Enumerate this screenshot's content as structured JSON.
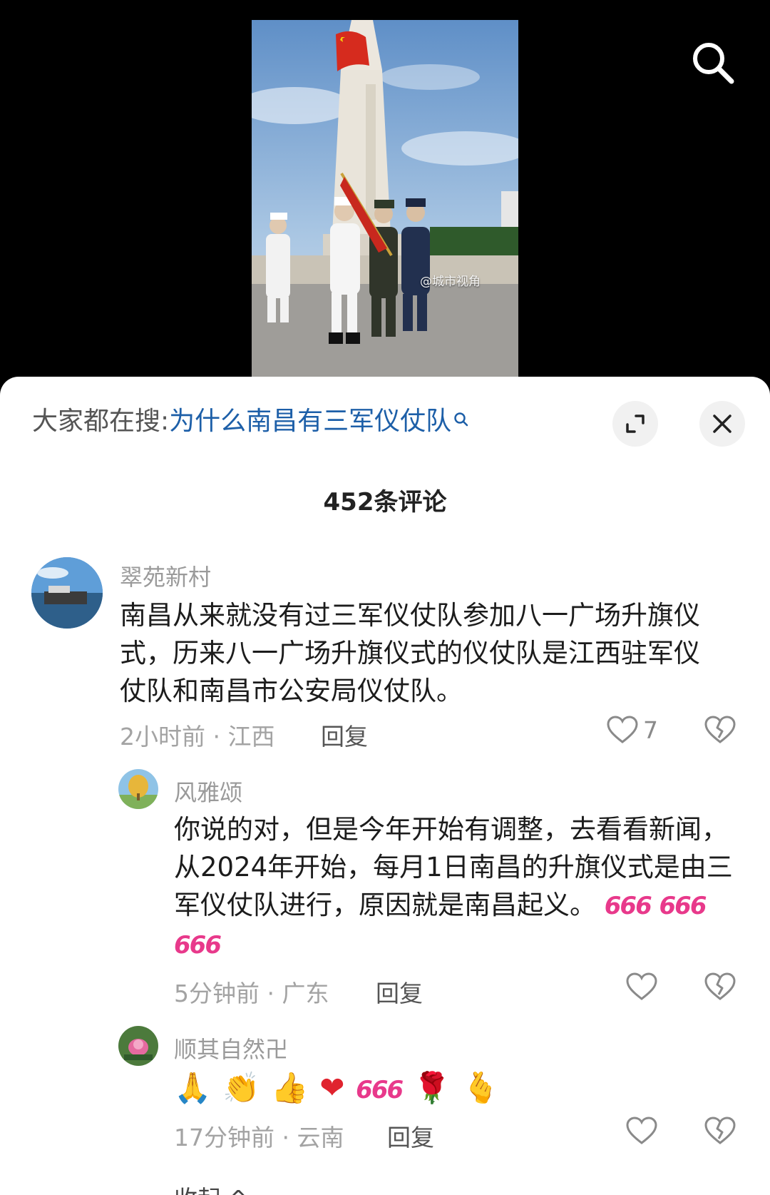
{
  "video": {
    "watermark": "@城市视角"
  },
  "header": {
    "hot_search_prefix": "大家都在搜:",
    "hot_search_query": "为什么南昌有三军仪仗队"
  },
  "comment_count": "452条评论",
  "comments": [
    {
      "user": "翠苑新村",
      "text": "南昌从来就没有过三军仪仗队参加八一广场升旗仪式，历来八一广场升旗仪式的仪仗队是江西驻军仪仗队和南昌市公安局仪仗队。",
      "meta": "2小时前 · 江西",
      "reply": "回复",
      "likes": "7"
    }
  ],
  "replies": [
    {
      "user": "风雅颂",
      "text": "你说的对，但是今年开始有调整，去看看新闻，从2024年开始，每月1日南昌的升旗仪式是由三军仪仗队进行，原因就是南昌起义。",
      "stickers": [
        "666",
        "666",
        "666"
      ],
      "meta": "5分钟前 · 广东",
      "reply": "回复"
    },
    {
      "user": "顺其自然卍",
      "emojis": [
        "🙏",
        "👏",
        "👍",
        "❤",
        "666",
        "🌹",
        "🫰"
      ],
      "meta": "17分钟前 · 云南",
      "reply": "回复"
    }
  ],
  "collapse_label": "收起 ^",
  "colors": {
    "link_blue": "#1d5fa8",
    "sticker_pink": "#e8398b"
  }
}
